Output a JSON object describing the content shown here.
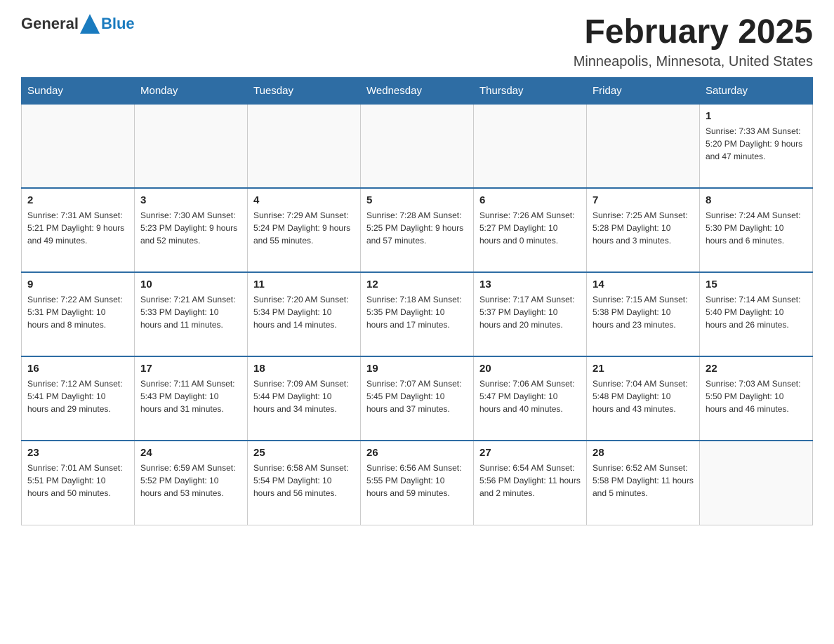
{
  "header": {
    "logo_general": "General",
    "logo_blue": "Blue",
    "title": "February 2025",
    "subtitle": "Minneapolis, Minnesota, United States"
  },
  "days_of_week": [
    "Sunday",
    "Monday",
    "Tuesday",
    "Wednesday",
    "Thursday",
    "Friday",
    "Saturday"
  ],
  "weeks": [
    [
      {
        "day": "",
        "info": ""
      },
      {
        "day": "",
        "info": ""
      },
      {
        "day": "",
        "info": ""
      },
      {
        "day": "",
        "info": ""
      },
      {
        "day": "",
        "info": ""
      },
      {
        "day": "",
        "info": ""
      },
      {
        "day": "1",
        "info": "Sunrise: 7:33 AM\nSunset: 5:20 PM\nDaylight: 9 hours and 47 minutes."
      }
    ],
    [
      {
        "day": "2",
        "info": "Sunrise: 7:31 AM\nSunset: 5:21 PM\nDaylight: 9 hours and 49 minutes."
      },
      {
        "day": "3",
        "info": "Sunrise: 7:30 AM\nSunset: 5:23 PM\nDaylight: 9 hours and 52 minutes."
      },
      {
        "day": "4",
        "info": "Sunrise: 7:29 AM\nSunset: 5:24 PM\nDaylight: 9 hours and 55 minutes."
      },
      {
        "day": "5",
        "info": "Sunrise: 7:28 AM\nSunset: 5:25 PM\nDaylight: 9 hours and 57 minutes."
      },
      {
        "day": "6",
        "info": "Sunrise: 7:26 AM\nSunset: 5:27 PM\nDaylight: 10 hours and 0 minutes."
      },
      {
        "day": "7",
        "info": "Sunrise: 7:25 AM\nSunset: 5:28 PM\nDaylight: 10 hours and 3 minutes."
      },
      {
        "day": "8",
        "info": "Sunrise: 7:24 AM\nSunset: 5:30 PM\nDaylight: 10 hours and 6 minutes."
      }
    ],
    [
      {
        "day": "9",
        "info": "Sunrise: 7:22 AM\nSunset: 5:31 PM\nDaylight: 10 hours and 8 minutes."
      },
      {
        "day": "10",
        "info": "Sunrise: 7:21 AM\nSunset: 5:33 PM\nDaylight: 10 hours and 11 minutes."
      },
      {
        "day": "11",
        "info": "Sunrise: 7:20 AM\nSunset: 5:34 PM\nDaylight: 10 hours and 14 minutes."
      },
      {
        "day": "12",
        "info": "Sunrise: 7:18 AM\nSunset: 5:35 PM\nDaylight: 10 hours and 17 minutes."
      },
      {
        "day": "13",
        "info": "Sunrise: 7:17 AM\nSunset: 5:37 PM\nDaylight: 10 hours and 20 minutes."
      },
      {
        "day": "14",
        "info": "Sunrise: 7:15 AM\nSunset: 5:38 PM\nDaylight: 10 hours and 23 minutes."
      },
      {
        "day": "15",
        "info": "Sunrise: 7:14 AM\nSunset: 5:40 PM\nDaylight: 10 hours and 26 minutes."
      }
    ],
    [
      {
        "day": "16",
        "info": "Sunrise: 7:12 AM\nSunset: 5:41 PM\nDaylight: 10 hours and 29 minutes."
      },
      {
        "day": "17",
        "info": "Sunrise: 7:11 AM\nSunset: 5:43 PM\nDaylight: 10 hours and 31 minutes."
      },
      {
        "day": "18",
        "info": "Sunrise: 7:09 AM\nSunset: 5:44 PM\nDaylight: 10 hours and 34 minutes."
      },
      {
        "day": "19",
        "info": "Sunrise: 7:07 AM\nSunset: 5:45 PM\nDaylight: 10 hours and 37 minutes."
      },
      {
        "day": "20",
        "info": "Sunrise: 7:06 AM\nSunset: 5:47 PM\nDaylight: 10 hours and 40 minutes."
      },
      {
        "day": "21",
        "info": "Sunrise: 7:04 AM\nSunset: 5:48 PM\nDaylight: 10 hours and 43 minutes."
      },
      {
        "day": "22",
        "info": "Sunrise: 7:03 AM\nSunset: 5:50 PM\nDaylight: 10 hours and 46 minutes."
      }
    ],
    [
      {
        "day": "23",
        "info": "Sunrise: 7:01 AM\nSunset: 5:51 PM\nDaylight: 10 hours and 50 minutes."
      },
      {
        "day": "24",
        "info": "Sunrise: 6:59 AM\nSunset: 5:52 PM\nDaylight: 10 hours and 53 minutes."
      },
      {
        "day": "25",
        "info": "Sunrise: 6:58 AM\nSunset: 5:54 PM\nDaylight: 10 hours and 56 minutes."
      },
      {
        "day": "26",
        "info": "Sunrise: 6:56 AM\nSunset: 5:55 PM\nDaylight: 10 hours and 59 minutes."
      },
      {
        "day": "27",
        "info": "Sunrise: 6:54 AM\nSunset: 5:56 PM\nDaylight: 11 hours and 2 minutes."
      },
      {
        "day": "28",
        "info": "Sunrise: 6:52 AM\nSunset: 5:58 PM\nDaylight: 11 hours and 5 minutes."
      },
      {
        "day": "",
        "info": ""
      }
    ]
  ]
}
